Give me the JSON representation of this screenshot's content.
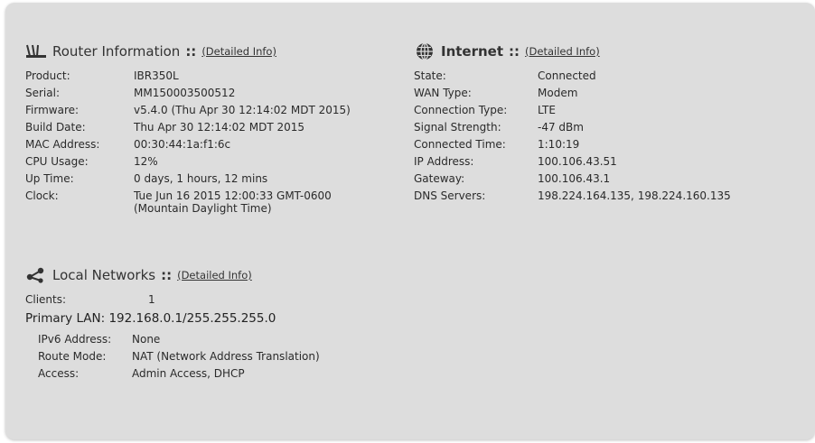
{
  "router": {
    "title": "Router Information",
    "separator": "::",
    "link": "(Detailed Info)",
    "icon": "router-antenna-icon",
    "rows": [
      {
        "label": "Product:",
        "value": "IBR350L"
      },
      {
        "label": "Serial:",
        "value": "MM150003500512"
      },
      {
        "label": "Firmware:",
        "value": "v5.4.0 (Thu Apr 30 12:14:02 MDT 2015)"
      },
      {
        "label": "Build Date:",
        "value": "Thu Apr 30 12:14:02 MDT 2015"
      },
      {
        "label": "MAC Address:",
        "value": "00:30:44:1a:f1:6c"
      },
      {
        "label": "CPU Usage:",
        "value": "12%"
      },
      {
        "label": "Up Time:",
        "value": "0 days, 1 hours, 12 mins"
      },
      {
        "label": "Clock:",
        "value": "Tue Jun 16 2015 12:00:33 GMT-0600 (Mountain Daylight Time)"
      }
    ]
  },
  "internet": {
    "title": "Internet",
    "separator": "::",
    "link": "(Detailed Info)",
    "icon": "globe-icon",
    "rows": [
      {
        "label": "State:",
        "value": "Connected"
      },
      {
        "label": "WAN Type:",
        "value": "Modem"
      },
      {
        "label": "Connection Type:",
        "value": "LTE"
      },
      {
        "label": "Signal Strength:",
        "value": "-47 dBm"
      },
      {
        "label": "Connected Time:",
        "value": "1:10:19"
      },
      {
        "label": "IP Address:",
        "value": "100.106.43.51"
      },
      {
        "label": "Gateway:",
        "value": "100.106.43.1"
      },
      {
        "label": "DNS Servers:",
        "value": "198.224.164.135, 198.224.160.135"
      }
    ]
  },
  "local": {
    "title": "Local Networks",
    "separator": "::",
    "link": "(Detailed Info)",
    "icon": "share-network-icon",
    "clients_label": "Clients:",
    "clients_value": "1",
    "primary_lan": "Primary LAN: 192.168.0.1/255.255.255.0",
    "lan_rows": [
      {
        "label": "IPv6 Address:",
        "value": "None"
      },
      {
        "label": "Route Mode:",
        "value": "NAT (Network Address Translation)"
      },
      {
        "label": "Access:",
        "value": "Admin Access, DHCP"
      }
    ]
  },
  "colors": {
    "panel_bg": "#dddddd",
    "text": "#2a2a2a",
    "icon": "#333333"
  }
}
